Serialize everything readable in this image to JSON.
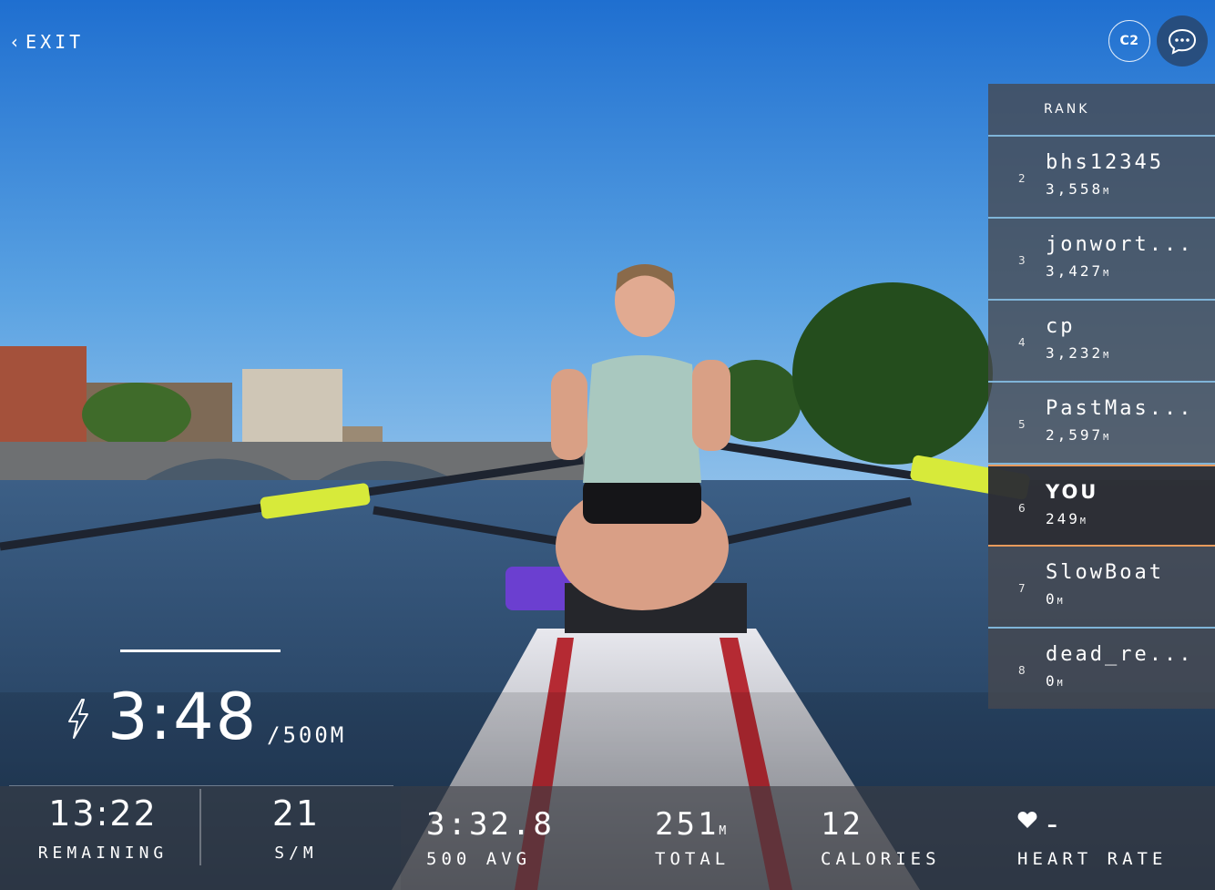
{
  "header": {
    "exit_label": "EXIT",
    "badge_label": "C2"
  },
  "leaderboard": {
    "title": "RANK",
    "rows": [
      {
        "rank": "2",
        "name": "bhs12345",
        "distance": "3,558",
        "unit": "M",
        "is_you": false
      },
      {
        "rank": "3",
        "name": "jonwort...",
        "distance": "3,427",
        "unit": "M",
        "is_you": false
      },
      {
        "rank": "4",
        "name": "cp",
        "distance": "3,232",
        "unit": "M",
        "is_you": false
      },
      {
        "rank": "5",
        "name": "PastMas...",
        "distance": "2,597",
        "unit": "M",
        "is_you": false
      },
      {
        "rank": "6",
        "name": "YOU",
        "distance": "249",
        "unit": "M",
        "is_you": true
      },
      {
        "rank": "7",
        "name": "SlowBoat",
        "distance": "0",
        "unit": "M",
        "is_you": false
      },
      {
        "rank": "8",
        "name": "dead_re...",
        "distance": "0",
        "unit": "M",
        "is_you": false
      }
    ]
  },
  "pace": {
    "value": "3:48",
    "unit": "/500M",
    "progress_fraction": 1.0
  },
  "stats_left": {
    "remaining_value": "13:22",
    "remaining_label": "REMAINING",
    "spm_value": "21",
    "spm_label": "S/M"
  },
  "stats_right": {
    "avg_value": "3:32.8",
    "avg_label": "500 AVG",
    "total_value": "251",
    "total_unit": "M",
    "total_label": "TOTAL",
    "calories_value": "12",
    "calories_label": "CALORIES",
    "heart_value": "-",
    "heart_label": "HEART RATE"
  },
  "colors": {
    "accent_blue": "#7fb4d8",
    "you_orange": "#e89a5c",
    "sky": "#3a86d8"
  },
  "icons": [
    "chevron-left-icon",
    "chat-bubble-icon",
    "lightning-icon",
    "heart-icon"
  ]
}
